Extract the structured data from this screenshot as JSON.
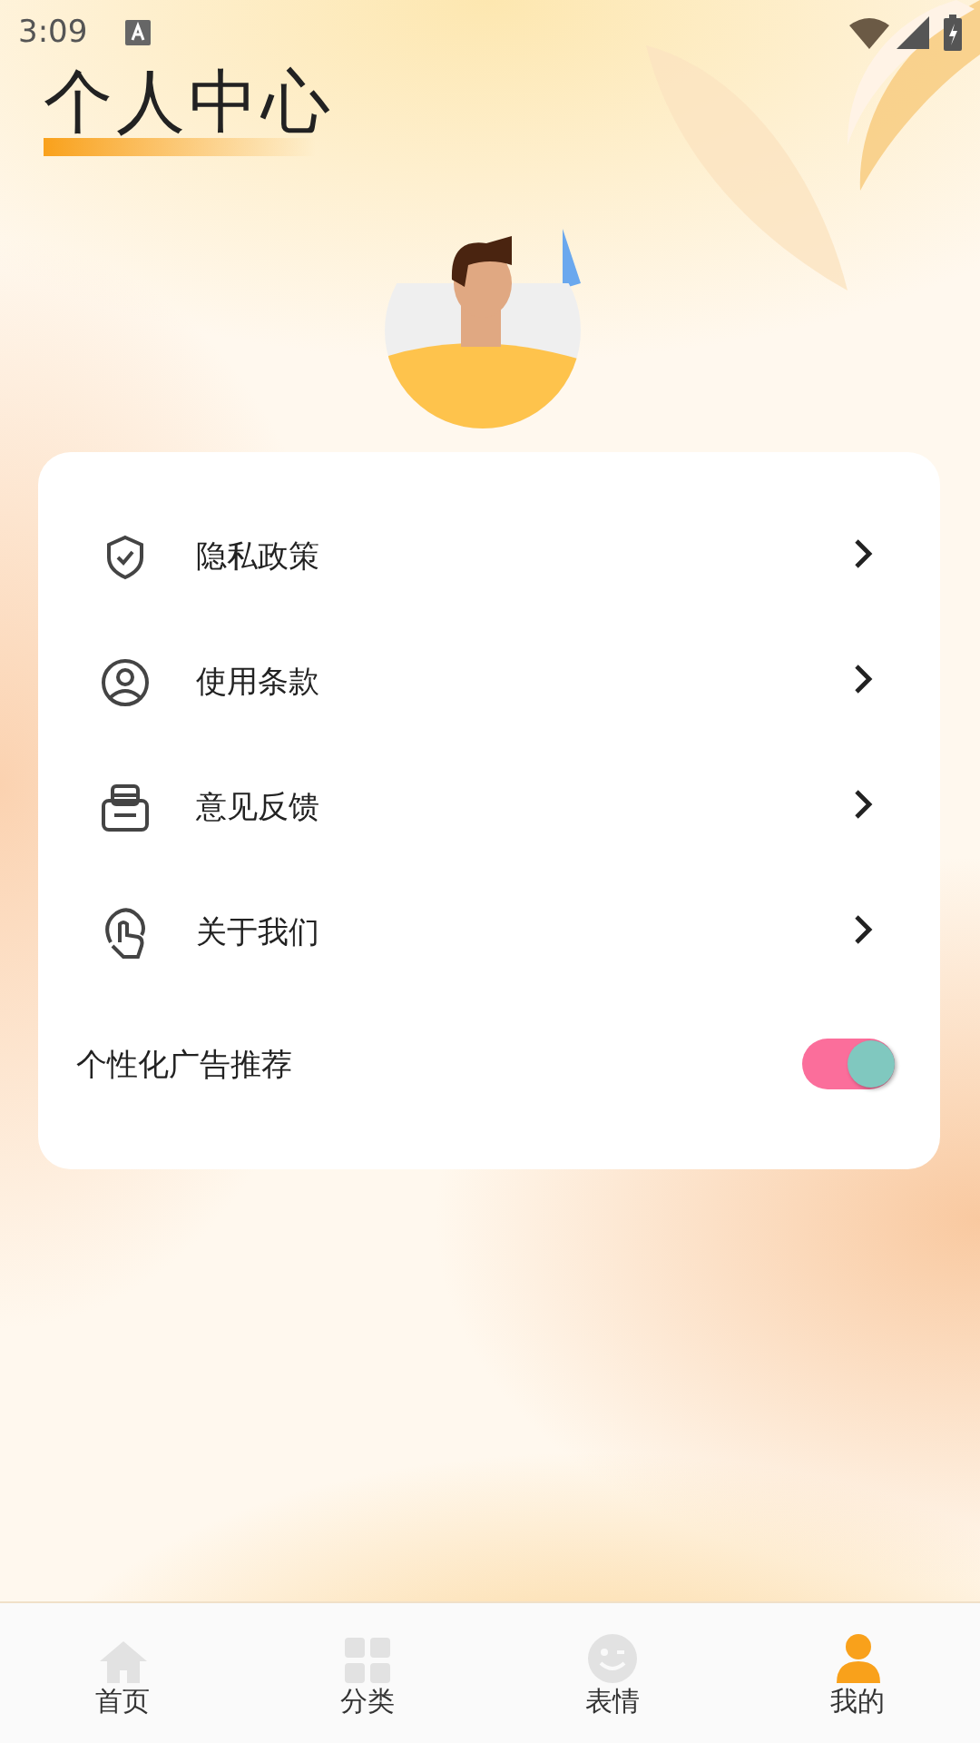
{
  "status_bar": {
    "time": "3:09"
  },
  "header": {
    "title": "个人中心"
  },
  "menu_items": [
    {
      "label": "隐私政策"
    },
    {
      "label": "使用条款"
    },
    {
      "label": "意见反馈"
    },
    {
      "label": "关于我们"
    }
  ],
  "ad_toggle": {
    "label": "个性化广告推荐",
    "on": true
  },
  "tabs": [
    {
      "label": "首页",
      "selected": false
    },
    {
      "label": "分类",
      "selected": false
    },
    {
      "label": "表情",
      "selected": false
    },
    {
      "label": "我的",
      "selected": true
    }
  ]
}
